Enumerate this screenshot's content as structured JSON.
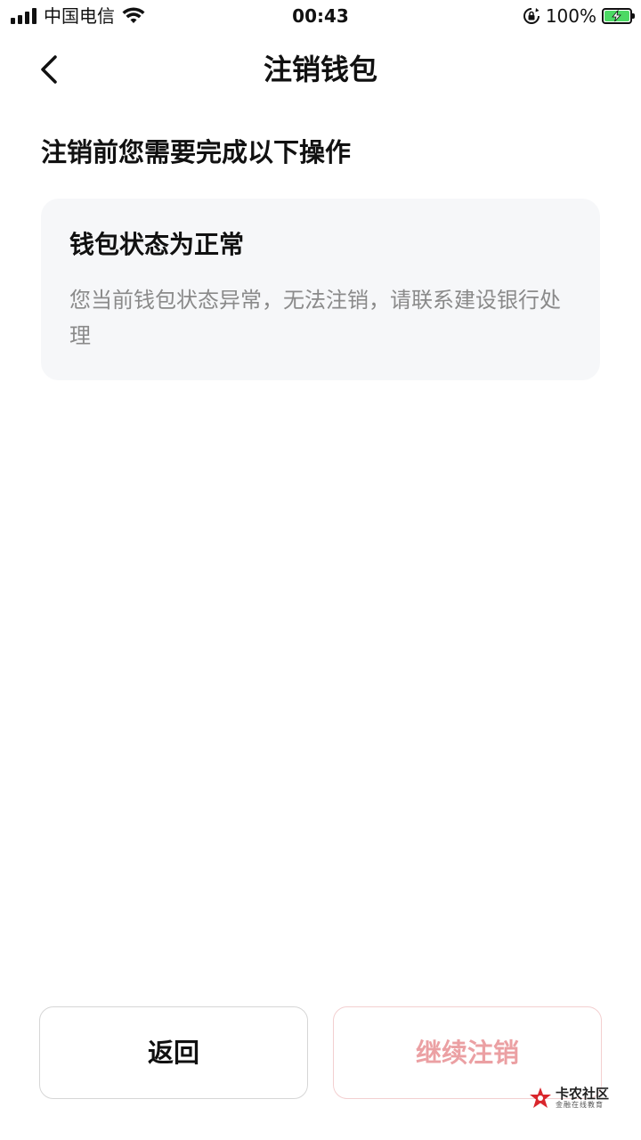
{
  "status_bar": {
    "carrier": "中国电信",
    "time": "00:43",
    "battery_percent": "100%",
    "battery_level": 1.0,
    "battery_color": "#4cd964",
    "icons": [
      "signal-icon",
      "wifi-icon",
      "rotation-lock-icon",
      "battery-charging-icon"
    ]
  },
  "nav": {
    "back_icon": "chevron-left-icon",
    "title": "注销钱包"
  },
  "main": {
    "section_heading": "注销前您需要完成以下操作",
    "card": {
      "title": "钱包状态为正常",
      "description": "您当前钱包状态异常，无法注销，请联系建设银行处理"
    }
  },
  "footer": {
    "back_label": "返回",
    "continue_label": "继续注销",
    "continue_color": "#eba0a3"
  },
  "watermark": {
    "main": "卡农社区",
    "sub": "金融在线教育",
    "logo_color": "#d9262c"
  }
}
